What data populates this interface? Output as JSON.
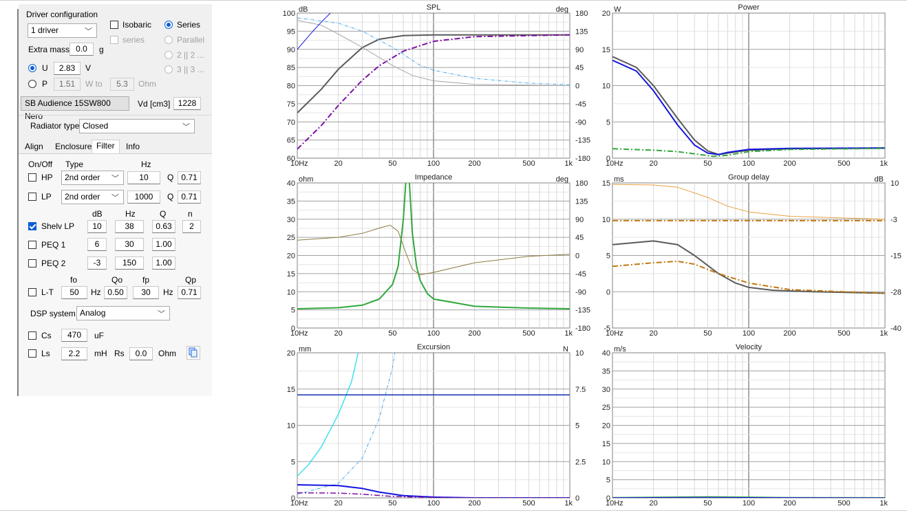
{
  "driver_config": {
    "group_label": "Driver configuration",
    "driver_count": "1 driver",
    "isobaric_label": "Isobaric",
    "isobaric_series_label": "series",
    "series_label": "Series",
    "parallel_label": "Parallel",
    "two_label": "2 || 2 ...",
    "three_label": "3 || 3 ...",
    "extra_mass_label": "Extra mass",
    "extra_mass_value": "0.0",
    "extra_mass_unit": "g",
    "u_label": "U",
    "u_value": "2.83",
    "u_unit": "V",
    "p_label": "P",
    "p_value": "1.51",
    "w_to_label": "W to",
    "ohm_value": "5.3",
    "ohm_unit": "Ohm",
    "driver_name": "SB Audience 15SW800 Nero",
    "vd_label": "Vd [cm3]",
    "vd_value": "1228"
  },
  "radiator": {
    "label": "Radiator type",
    "value": "Closed"
  },
  "tabs": [
    "Align",
    "Enclosure",
    "Filter",
    "Info"
  ],
  "filter": {
    "headers": {
      "onoff": "On/Off",
      "type": "Type",
      "hz": "Hz"
    },
    "hp": {
      "label": "HP",
      "type": "2nd order",
      "hz": "10",
      "q_label": "Q",
      "q": "0.71"
    },
    "lp": {
      "label": "LP",
      "type": "2nd order",
      "hz": "1000",
      "q_label": "Q",
      "q": "0.71"
    },
    "shelv_headers": {
      "db": "dB",
      "hz": "Hz",
      "q": "Q",
      "n": "n"
    },
    "shelv": {
      "label": "Shelv LP",
      "db": "10",
      "hz": "38",
      "q": "0.63",
      "n": "2"
    },
    "peq1": {
      "label": "PEQ 1",
      "db": "6",
      "hz": "30",
      "q": "1.00"
    },
    "peq2": {
      "label": "PEQ 2",
      "db": "-3",
      "hz": "150",
      "q": "1.00"
    },
    "lt_headers": {
      "fo": "fo",
      "qo": "Qo",
      "fp": "fp",
      "qp": "Qp"
    },
    "lt": {
      "label": "L-T",
      "fo": "50",
      "hz1": "Hz",
      "qo": "0.50",
      "fp": "30",
      "hz2": "Hz",
      "qp": "0.71"
    },
    "dsp_label": "DSP system",
    "dsp_value": "Analog",
    "cs": {
      "label": "Cs",
      "value": "470",
      "unit": "uF"
    },
    "ls": {
      "label": "Ls",
      "value": "2.2",
      "unit": "mH",
      "rs_label": "Rs",
      "rs_value": "0.0",
      "rs_unit": "Ohm"
    }
  },
  "colors": {
    "gray": "#5a5a5a",
    "lightgray": "#a8a8a8",
    "purple": "#7b0fa3",
    "blue": "#1414e0",
    "lightblue": "#4aa8e8",
    "darkblue": "#1030b0",
    "cyan": "#40e0f0",
    "green": "#2fa83a",
    "olive": "#8c7a40",
    "orange": "#e8a040",
    "darkorange": "#c07810"
  },
  "chart_data": [
    {
      "type": "line",
      "title": "SPL",
      "ylabel": "dB",
      "y2label": "deg",
      "xscale": "log",
      "xlim": [
        10,
        1000
      ],
      "x_ticks": [
        "10Hz",
        "20",
        "50",
        "100",
        "200",
        "500",
        "1k"
      ],
      "ylim": [
        60,
        100
      ],
      "y_ticks": [
        "100",
        "95",
        "90",
        "85",
        "80",
        "75",
        "70",
        "65",
        "60"
      ],
      "y2lim": [
        -180,
        180
      ],
      "y2_ticks": [
        "180",
        "135",
        "90",
        "45",
        "0",
        "-45",
        "-90",
        "-135",
        "-180"
      ],
      "series": [
        {
          "color": "gray",
          "axis": "y",
          "width": 2,
          "points": [
            [
              10,
              72.5
            ],
            [
              15,
              79
            ],
            [
              20,
              84.5
            ],
            [
              30,
              90.5
            ],
            [
              40,
              92.8
            ],
            [
              60,
              93.8
            ],
            [
              100,
              94
            ],
            [
              1000,
              94
            ]
          ]
        },
        {
          "color": "purple",
          "axis": "y",
          "dash": "8,3,2,3",
          "width": 2,
          "points": [
            [
              10,
              62.5
            ],
            [
              15,
              69
            ],
            [
              20,
              74.5
            ],
            [
              30,
              81.5
            ],
            [
              40,
              85.5
            ],
            [
              60,
              89.5
            ],
            [
              100,
              92.2
            ],
            [
              200,
              93.5
            ],
            [
              1000,
              94
            ]
          ]
        },
        {
          "color": "lightgray",
          "axis": "y2",
          "width": 1,
          "points": [
            [
              10,
              162
            ],
            [
              15,
              150
            ],
            [
              20,
              128
            ],
            [
              30,
              95
            ],
            [
              50,
              50
            ],
            [
              70,
              25
            ],
            [
              100,
              12
            ],
            [
              200,
              3
            ],
            [
              1000,
              0
            ]
          ]
        },
        {
          "color": "lightblue",
          "axis": "y2",
          "dash": "5,2,1,2",
          "width": 1,
          "points": [
            [
              10,
              168
            ],
            [
              20,
              155
            ],
            [
              30,
              135
            ],
            [
              50,
              95
            ],
            [
              80,
              50
            ],
            [
              100,
              38
            ],
            [
              200,
              18
            ],
            [
              500,
              6
            ],
            [
              1000,
              2
            ]
          ]
        },
        {
          "color": "blue",
          "axis": "y",
          "width": 1,
          "points": [
            [
              10,
              90
            ],
            [
              13,
              95
            ],
            [
              15,
              97.5
            ],
            [
              17.5,
              100
            ]
          ]
        }
      ]
    },
    {
      "type": "line",
      "title": "Power",
      "ylabel": "W",
      "xscale": "log",
      "xlim": [
        10,
        1000
      ],
      "x_ticks": [
        "10Hz",
        "20",
        "50",
        "100",
        "200",
        "500",
        "1k"
      ],
      "ylim": [
        0,
        20
      ],
      "y_ticks": [
        "20",
        "15",
        "10",
        "5",
        "0"
      ],
      "series": [
        {
          "color": "gray",
          "width": 2,
          "points": [
            [
              10,
              14
            ],
            [
              15,
              12.5
            ],
            [
              20,
              10
            ],
            [
              30,
              5.5
            ],
            [
              40,
              2.5
            ],
            [
              50,
              1
            ],
            [
              60,
              0.5
            ],
            [
              70,
              0.7
            ],
            [
              100,
              1.1
            ],
            [
              200,
              1.3
            ],
            [
              1000,
              1.4
            ]
          ]
        },
        {
          "color": "blue",
          "width": 2,
          "points": [
            [
              10,
              13.5
            ],
            [
              15,
              12
            ],
            [
              20,
              9.3
            ],
            [
              30,
              4.6
            ],
            [
              40,
              1.8
            ],
            [
              50,
              0.7
            ],
            [
              60,
              0.5
            ],
            [
              70,
              0.8
            ],
            [
              100,
              1.2
            ],
            [
              200,
              1.35
            ],
            [
              1000,
              1.4
            ]
          ]
        },
        {
          "color": "green",
          "dash": "8,3,2,3",
          "width": 2,
          "points": [
            [
              10,
              1.3
            ],
            [
              20,
              1.1
            ],
            [
              30,
              0.9
            ],
            [
              40,
              0.6
            ],
            [
              55,
              0.25
            ],
            [
              70,
              0.4
            ],
            [
              100,
              0.9
            ],
            [
              200,
              1.2
            ],
            [
              1000,
              1.35
            ]
          ]
        }
      ]
    },
    {
      "type": "line",
      "title": "Impedance",
      "ylabel": "ohm",
      "y2label": "deg",
      "xscale": "log",
      "xlim": [
        10,
        1000
      ],
      "x_ticks": [
        "10Hz",
        "20",
        "50",
        "100",
        "200",
        "500",
        "1k"
      ],
      "ylim": [
        0,
        40
      ],
      "y_ticks": [
        "40",
        "35",
        "30",
        "25",
        "20",
        "15",
        "10",
        "5",
        "0"
      ],
      "y2lim": [
        -180,
        180
      ],
      "y2_ticks": [
        "180",
        "135",
        "90",
        "45",
        "0",
        "-45",
        "-90",
        "-135",
        "-180"
      ],
      "series": [
        {
          "color": "green",
          "axis": "y",
          "width": 2,
          "points": [
            [
              10,
              5.3
            ],
            [
              20,
              5.6
            ],
            [
              30,
              6.3
            ],
            [
              40,
              8
            ],
            [
              50,
              12
            ],
            [
              55,
              17
            ],
            [
              60,
              30
            ],
            [
              63,
              42
            ],
            [
              66,
              42
            ],
            [
              70,
              26
            ],
            [
              75,
              17
            ],
            [
              80,
              13
            ],
            [
              90,
              9.5
            ],
            [
              100,
              8
            ],
            [
              200,
              6
            ],
            [
              500,
              5.5
            ],
            [
              1000,
              5.3
            ]
          ]
        },
        {
          "color": "olive",
          "axis": "y2",
          "width": 1,
          "points": [
            [
              10,
              38
            ],
            [
              20,
              45
            ],
            [
              30,
              55
            ],
            [
              40,
              68
            ],
            [
              48,
              75
            ],
            [
              55,
              60
            ],
            [
              62,
              10
            ],
            [
              70,
              -35
            ],
            [
              80,
              -48
            ],
            [
              100,
              -42
            ],
            [
              200,
              -18
            ],
            [
              500,
              -2
            ],
            [
              1000,
              3
            ]
          ]
        }
      ]
    },
    {
      "type": "line",
      "title": "Group delay",
      "ylabel": "ms",
      "y2label": "dB",
      "xscale": "log",
      "xlim": [
        10,
        1000
      ],
      "x_ticks": [
        "10Hz",
        "20",
        "50",
        "100",
        "200",
        "500",
        "1k"
      ],
      "ylim": [
        -5,
        15
      ],
      "y_ticks": [
        "15",
        "10",
        "5",
        "0",
        "-5"
      ],
      "y2lim": [
        -40,
        10
      ],
      "y2_ticks": [
        "10",
        "-3",
        "-15",
        "-28",
        "-40"
      ],
      "series": [
        {
          "color": "gray",
          "axis": "y",
          "width": 2,
          "points": [
            [
              10,
              6.5
            ],
            [
              20,
              7
            ],
            [
              30,
              6.5
            ],
            [
              40,
              5
            ],
            [
              60,
              2.5
            ],
            [
              80,
              1.2
            ],
            [
              100,
              0.6
            ],
            [
              150,
              0.2
            ],
            [
              300,
              0
            ],
            [
              1000,
              -0.2
            ]
          ]
        },
        {
          "color": "orange",
          "axis": "y2",
          "width": 1,
          "points": [
            [
              10,
              9.5
            ],
            [
              20,
              9.3
            ],
            [
              30,
              8.5
            ],
            [
              50,
              5
            ],
            [
              70,
              2
            ],
            [
              100,
              0
            ],
            [
              200,
              -1.5
            ],
            [
              1000,
              -2.5
            ]
          ]
        },
        {
          "color": "darkorange",
          "axis": "y2",
          "dash": "8,3,2,3",
          "width": 2,
          "points": [
            [
              10,
              -3
            ],
            [
              1000,
              -3
            ]
          ]
        },
        {
          "color": "darkorange",
          "axis": "y",
          "dash": "8,3,2,3",
          "width": 2,
          "points": [
            [
              10,
              3.5
            ],
            [
              20,
              4
            ],
            [
              30,
              4.2
            ],
            [
              40,
              3.8
            ],
            [
              60,
              2.5
            ],
            [
              100,
              1.2
            ],
            [
              200,
              0.3
            ],
            [
              500,
              0
            ],
            [
              1000,
              -0.2
            ]
          ]
        }
      ]
    },
    {
      "type": "line",
      "title": "Excursion",
      "ylabel": "mm",
      "y2label": "N",
      "xscale": "log",
      "xlim": [
        10,
        1000
      ],
      "x_ticks": [
        "10Hz",
        "20",
        "50",
        "100",
        "200",
        "500",
        "1k"
      ],
      "ylim": [
        0,
        20
      ],
      "y_ticks": [
        "20",
        "15",
        "10",
        "5",
        "0"
      ],
      "y2lim": [
        0,
        10
      ],
      "y2_ticks": [
        "10",
        "7.5",
        "5",
        "2.5",
        "0"
      ],
      "series": [
        {
          "color": "cyan",
          "axis": "y",
          "width": 1.5,
          "points": [
            [
              10,
              3
            ],
            [
              12,
              4.5
            ],
            [
              15,
              7
            ],
            [
              20,
              11.5
            ],
            [
              25,
              16
            ],
            [
              28,
              20
            ]
          ]
        },
        {
          "color": "lightblue",
          "axis": "y",
          "dash": "5,2,1,2",
          "width": 1,
          "points": [
            [
              10,
              0.5
            ],
            [
              20,
              2
            ],
            [
              30,
              5.5
            ],
            [
              40,
              11
            ],
            [
              50,
              18
            ],
            [
              52,
              20
            ]
          ]
        },
        {
          "color": "blue",
          "axis": "y",
          "width": 2,
          "points": [
            [
              10,
              1.8
            ],
            [
              20,
              1.7
            ],
            [
              30,
              1.3
            ],
            [
              40,
              0.8
            ],
            [
              60,
              0.3
            ],
            [
              100,
              0.1
            ],
            [
              200,
              0
            ],
            [
              1000,
              0
            ]
          ]
        },
        {
          "color": "purple",
          "axis": "y",
          "dash": "8,3,2,3",
          "width": 1.5,
          "points": [
            [
              10,
              0.7
            ],
            [
              20,
              0.65
            ],
            [
              30,
              0.5
            ],
            [
              50,
              0.2
            ],
            [
              100,
              0.05
            ],
            [
              200,
              0
            ],
            [
              1000,
              0
            ]
          ]
        },
        {
          "color": "darkblue",
          "axis": "y",
          "width": 1.5,
          "points": [
            [
              10,
              14.2
            ],
            [
              1000,
              14.2
            ]
          ]
        }
      ]
    },
    {
      "type": "line",
      "title": "Velocity",
      "ylabel": "m/s",
      "xscale": "log",
      "xlim": [
        10,
        1000
      ],
      "x_ticks": [
        "10Hz",
        "20",
        "50",
        "100",
        "200",
        "500",
        "1k"
      ],
      "ylim": [
        0,
        40
      ],
      "y_ticks": [
        "40",
        "35",
        "30",
        "25",
        "20",
        "15",
        "10",
        "5",
        "0"
      ],
      "series": [
        {
          "color": "green",
          "width": 1.5,
          "points": [
            [
              10,
              0.1
            ],
            [
              30,
              0.25
            ],
            [
              50,
              0.3
            ],
            [
              100,
              0.2
            ],
            [
              200,
              0.1
            ],
            [
              1000,
              0.05
            ]
          ]
        },
        {
          "color": "blue",
          "width": 1,
          "points": [
            [
              10,
              0.05
            ],
            [
              40,
              0.15
            ],
            [
              100,
              0.1
            ],
            [
              1000,
              0.02
            ]
          ]
        }
      ]
    }
  ]
}
